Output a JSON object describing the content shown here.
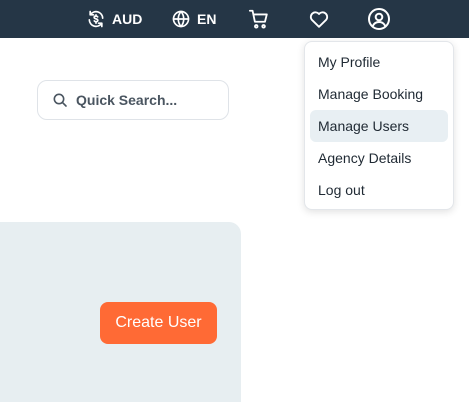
{
  "topbar": {
    "currency": {
      "icon": "currency-exchange-icon",
      "label": "AUD"
    },
    "language": {
      "icon": "globe-icon",
      "label": "EN"
    },
    "cart_icon": "cart-icon",
    "wishlist_icon": "heart-icon",
    "account_icon": "user-circle-icon"
  },
  "search": {
    "placeholder": "Quick Search...",
    "value": "",
    "icon": "search-icon"
  },
  "account_menu": {
    "items": [
      {
        "label": "My Profile"
      },
      {
        "label": "Manage Booking"
      },
      {
        "label": "Manage Users",
        "active": true
      },
      {
        "label": "Agency Details"
      },
      {
        "label": "Log out"
      }
    ]
  },
  "actions": {
    "create_user_label": "Create User"
  },
  "colors": {
    "topbar_bg": "#253646",
    "panel_bg": "#e7eef1",
    "primary_button": "#ff6a35",
    "menu_highlight": "#e8eff3"
  }
}
